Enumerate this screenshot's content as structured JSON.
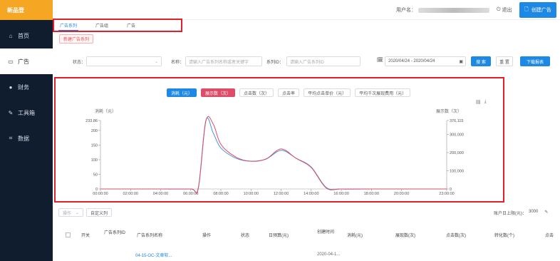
{
  "sidebar": {
    "logo": "新品登",
    "items": [
      {
        "label": "首页",
        "icon": "home-icon",
        "glyph": "⌂"
      },
      {
        "label": "广告",
        "icon": "ad-icon",
        "glyph": "▭"
      },
      {
        "label": "财务",
        "icon": "finance-icon",
        "glyph": "●"
      },
      {
        "label": "工具箱",
        "icon": "tools-icon",
        "glyph": "✎"
      },
      {
        "label": "数据",
        "icon": "data-icon",
        "glyph": "⌗"
      }
    ]
  },
  "header": {
    "user_label": "用户名：",
    "logout": "退出",
    "create_button": "创建广告"
  },
  "tabs": [
    "广告系列",
    "广告组",
    "广告"
  ],
  "new_series_button": "新建广告系列",
  "filters": {
    "status_label": "状态：",
    "status_value": "",
    "name_label": "名称：",
    "name_placeholder": "请输入广告系列名称或者关键字",
    "series_id_label": "系列ID：",
    "series_id_placeholder": "请输入广告系列ID",
    "date_range": "2020/04/24 - 2020/04/24",
    "search_button": "搜 索",
    "reset_button": "重 置",
    "download_button": "下载报表"
  },
  "metrics": [
    {
      "label": "消耗（元）",
      "state": "blue"
    },
    {
      "label": "展示数（次）",
      "state": "pink"
    },
    {
      "label": "点击数（次）",
      "state": "plain"
    },
    {
      "label": "点击率",
      "state": "plain"
    },
    {
      "label": "平均点击单价（元）",
      "state": "plain"
    },
    {
      "label": "平均千次展现费用（元）",
      "state": "plain"
    }
  ],
  "chart_data": {
    "type": "line",
    "left_axis_label": "消耗（元）",
    "right_axis_label": "展示数（次）",
    "x_ticks": [
      "00:00:00",
      "02:00:00",
      "04:00:00",
      "06:00:00",
      "08:00:00",
      "10:00:00",
      "12:00:00",
      "14:00:00",
      "16:00:00",
      "18:00:00",
      "20:00:00",
      "23:00:00"
    ],
    "left_ticks": [
      "0",
      "50",
      "100",
      "150",
      "200",
      "233.86"
    ],
    "right_ticks": [
      "0",
      "100,000",
      "200,000",
      "300,000",
      "376,115"
    ],
    "ylim": [
      0,
      233.86
    ],
    "ylim_right": [
      0,
      376115
    ],
    "x": [
      0,
      2,
      4,
      6,
      6.5,
      7,
      7.5,
      8,
      9,
      10,
      11,
      12,
      13,
      14,
      15,
      16,
      18,
      20,
      23
    ],
    "series": [
      {
        "name": "消耗（元）",
        "color": "#4a90d9",
        "axis": "left",
        "values": [
          0,
          0,
          0,
          0,
          5,
          233.86,
          190,
          140,
          105,
          95,
          102,
          132,
          105,
          75,
          5,
          0,
          0,
          0,
          0
        ]
      },
      {
        "name": "展示数（次）",
        "color": "#dd4d68",
        "axis": "right",
        "values": [
          0,
          0,
          0,
          0,
          3000,
          372000,
          355000,
          245000,
          175000,
          152000,
          165000,
          220000,
          168000,
          118000,
          5000,
          0,
          0,
          0,
          0
        ]
      }
    ]
  },
  "table": {
    "batch_select": "操作",
    "custom_columns": "自定义列",
    "budget_label": "账户日上限(元)：",
    "budget_value": "3000",
    "headers": [
      "开关",
      "广告系列ID",
      "广告系列名称",
      "操作",
      "状态",
      "日预算(元)",
      "创建时间",
      "消耗(元)",
      "展现数(次)",
      "点击数(次)",
      "转化数(个)",
      "点击"
    ],
    "first_row": {
      "name": "04-15-OC-文章软...",
      "date": "2020-04-1..."
    }
  }
}
